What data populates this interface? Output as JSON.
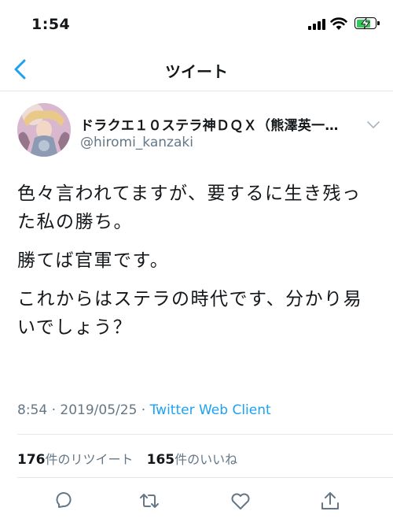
{
  "status_bar": {
    "time": "1:54",
    "battery_percent": 80
  },
  "nav": {
    "title": "ツイート"
  },
  "author": {
    "display_name": "ドラクエ１０ステラ神ＤＱＸ（熊澤英一…",
    "username": "@hiromi_kanzaki"
  },
  "tweet": {
    "paragraphs": [
      "色々言われてますが、要するに生き残った私の勝ち。",
      "勝てば官軍です。",
      "これからはステラの時代です、分かり易いでしょう？"
    ]
  },
  "meta": {
    "time": "8:54",
    "separator1": " · ",
    "date": "2019/05/25",
    "separator2": " · ",
    "client": "Twitter Web Client"
  },
  "stats": {
    "retweets_count": "176",
    "retweets_label": "件のリツイート",
    "likes_count": "165",
    "likes_label": "件のいいね"
  },
  "colors": {
    "accent": "#1da1f2",
    "secondary_text": "#657786",
    "battery": "#34c759"
  },
  "icons": {
    "actions": [
      "reply-icon",
      "retweet-icon",
      "like-icon",
      "share-icon"
    ]
  }
}
